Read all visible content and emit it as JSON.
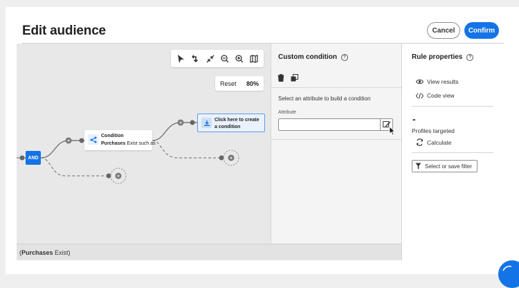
{
  "header": {
    "title": "Edit audience",
    "cancel_label": "Cancel",
    "confirm_label": "Confirm"
  },
  "canvas": {
    "toolbar_icons": [
      "select-pointer-icon",
      "move-branch-icon",
      "collapse-icon",
      "zoom-out-icon",
      "zoom-in-icon",
      "map-icon"
    ],
    "reset_label": "Reset",
    "zoom_level": "80%",
    "and_label": "AND",
    "condition_title": "Condition",
    "condition_sub_bold": "Purchases",
    "condition_sub_rest": "Exist such as",
    "create_text": "Click here to create a condition",
    "footer_bold": "Purchases",
    "footer_open": "(",
    "footer_rest": " Exist)"
  },
  "middle": {
    "heading": "Custom condition",
    "prompt": "Select an attribute to build a condition",
    "attribute_label": "Attribute",
    "attribute_value": ""
  },
  "right": {
    "heading": "Rule properties",
    "view_results": "View results",
    "code_view": "Code view",
    "count": "-",
    "profiles_targeted": "Profiles targeted",
    "calculate": "Calculate",
    "filter": "Select or save filter"
  },
  "colors": {
    "accent": "#1473e6",
    "canvas_bg": "#e8e8e8",
    "create_node_bg": "#e9f2fd"
  }
}
